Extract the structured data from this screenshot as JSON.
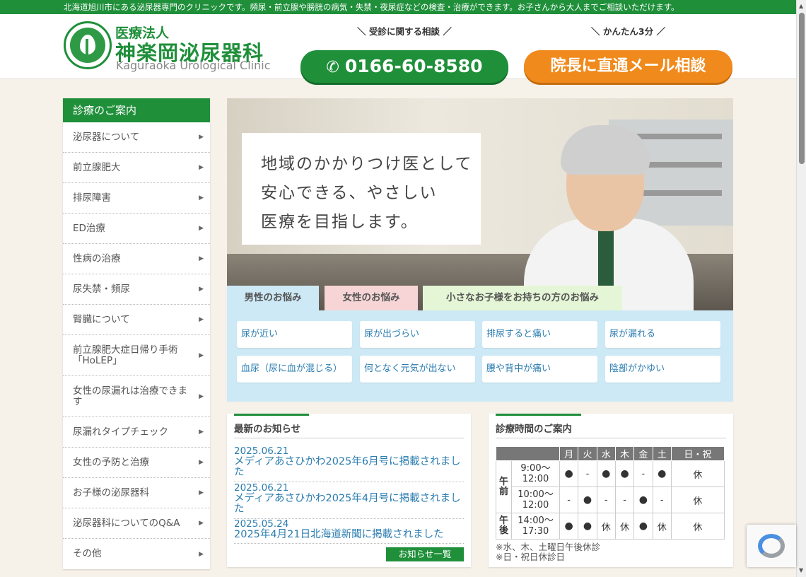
{
  "topbar": {
    "text": "北海道旭川市にある泌尿器専門のクリニックです。頻尿・前立腺や膀胱の病気・失禁・夜尿症などの検査・治療ができます。お子さんから大人までご相談いただけます。"
  },
  "header": {
    "logo_sub": "医療法人",
    "logo_main": "神楽岡泌尿器科",
    "logo_en": "Kaguraoka Urological Clinic",
    "phone_label": "＼ 受診に関する相談 ／",
    "phone_number": "0166-60-8580",
    "mail_label": "＼ かんたん3分 ／",
    "mail_button": "院長に直通メール相談"
  },
  "sidebar": {
    "title": "診療のご案内",
    "items": [
      {
        "label": "泌尿器について"
      },
      {
        "label": "前立腺肥大"
      },
      {
        "label": "排尿障害"
      },
      {
        "label": "ED治療"
      },
      {
        "label": "性病の治療"
      },
      {
        "label": "尿失禁・頻尿"
      },
      {
        "label": "腎臓について"
      },
      {
        "label": "前立腺肥大症日帰り手術「HoLEP」"
      },
      {
        "label": "女性の尿漏れは治療できます"
      },
      {
        "label": "尿漏れタイプチェック"
      },
      {
        "label": "女性の予防と治療"
      },
      {
        "label": "お子様の泌尿器科"
      },
      {
        "label": "泌尿器科についてのQ&A"
      },
      {
        "label": "その他"
      }
    ]
  },
  "hero": {
    "lines": [
      "地域のかかりつけ医として",
      "安心できる、やさしい",
      "医療を目指します。"
    ]
  },
  "tabs": {
    "men": "男性のお悩み",
    "women": "女性のお悩み",
    "kids": "小さなお子様をお持ちの方のお悩み"
  },
  "symptoms": [
    "尿が近い",
    "尿が出づらい",
    "排尿すると痛い",
    "尿が漏れる",
    "血尿（尿に血が混じる）",
    "何となく元気が出ない",
    "腰や背中が痛い",
    "陰部がかゆい"
  ],
  "news": {
    "title": "最新のお知らせ",
    "items": [
      {
        "date": "2025.06.21",
        "title": "メディアあさひかわ2025年6月号に掲載されました"
      },
      {
        "date": "2025.06.21",
        "title": "メディアあさひかわ2025年4月号に掲載されました"
      },
      {
        "date": "2025.05.24",
        "title": "2025年4月21日北海道新聞に掲載されました"
      }
    ],
    "more": "お知らせ一覧"
  },
  "hours": {
    "title": "診療時間のご案内",
    "days": [
      "月",
      "火",
      "水",
      "木",
      "金",
      "土",
      "日・祝"
    ],
    "am_label": "午前",
    "pm_label": "午後",
    "rows": [
      {
        "time_start": "9:00〜",
        "time_end": "12:00",
        "cells": [
          "●",
          "-",
          "●",
          "●",
          "-",
          "●",
          "休"
        ]
      },
      {
        "time_start": "10:00〜",
        "time_end": "12:00",
        "cells": [
          "-",
          "●",
          "-",
          "-",
          "●",
          "-",
          "休"
        ]
      },
      {
        "time_start": "14:00〜",
        "time_end": "17:30",
        "cells": [
          "●",
          "●",
          "休",
          "休",
          "●",
          "休",
          "休"
        ]
      }
    ],
    "notes": [
      "※水、木、土曜日午後休診",
      "※日・祝日休診日"
    ]
  },
  "colors": {
    "brand_green": "#1f8f3a",
    "accent_orange": "#f08a1c",
    "link_blue": "#2a7cb0",
    "closed_red": "#e03030"
  }
}
